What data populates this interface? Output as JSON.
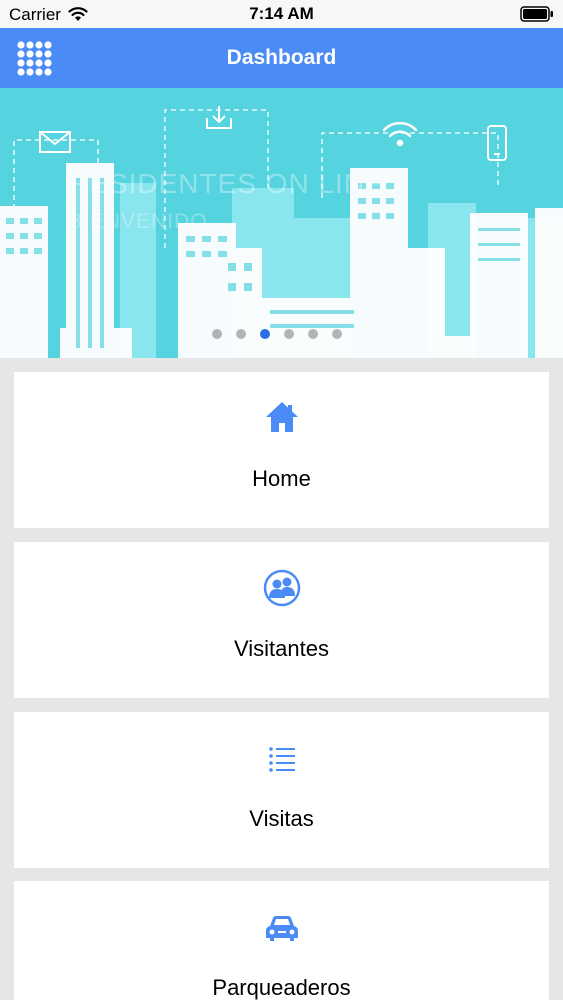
{
  "status_bar": {
    "carrier": "Carrier",
    "time": "7:14 AM"
  },
  "nav": {
    "title": "Dashboard",
    "menu_icon": "grid-menu-icon"
  },
  "banner": {
    "title": "RESIDENTES ON LINE",
    "subtitle": "BIENVENIDO",
    "pages": 6,
    "active_page": 2
  },
  "menu_items": [
    {
      "label": "Home",
      "icon": "home-icon"
    },
    {
      "label": "Visitantes",
      "icon": "visitors-icon"
    },
    {
      "label": "Visitas",
      "icon": "list-icon"
    },
    {
      "label": "Parqueaderos",
      "icon": "car-icon"
    }
  ],
  "colors": {
    "accent": "#4a8bf5",
    "banner": "#55d3df",
    "background": "#e6e6e6"
  }
}
